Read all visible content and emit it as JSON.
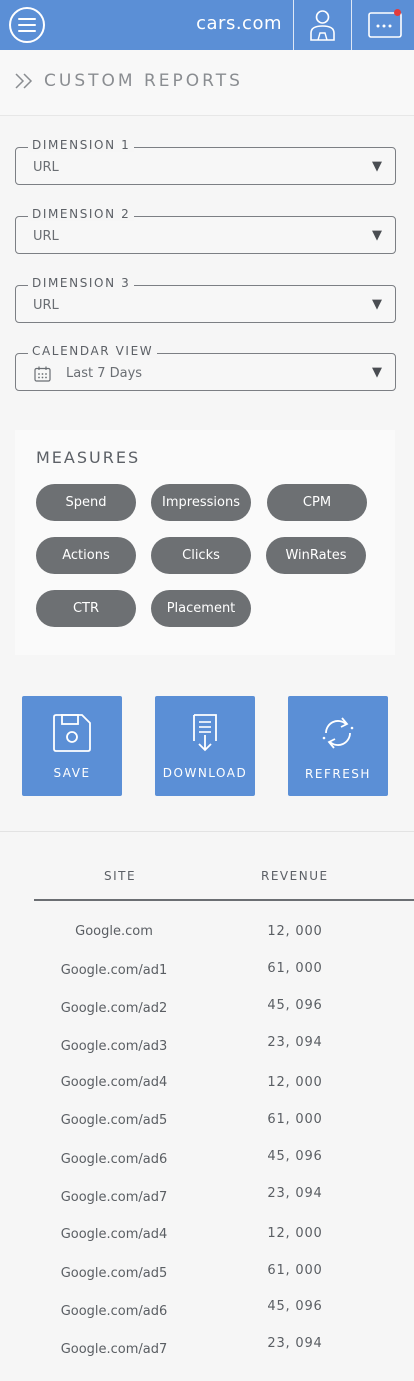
{
  "header": {
    "brand": "cars.com"
  },
  "page": {
    "title": "CUSTOM REPORTS"
  },
  "dimensions": [
    {
      "label": "DIMENSION 1",
      "value": "URL"
    },
    {
      "label": "DIMENSION 2",
      "value": "URL"
    },
    {
      "label": "DIMENSION 3",
      "value": "URL"
    }
  ],
  "calendar": {
    "label": "CALENDAR VIEW",
    "value": "Last 7 Days"
  },
  "measures": {
    "title": "MEASURES",
    "chips": [
      "Spend",
      "Impressions",
      "CPM",
      "Actions",
      "Clicks",
      "WinRates",
      "CTR",
      "Placement"
    ]
  },
  "actions": {
    "save": "SAVE",
    "download": "DOWNLOAD",
    "refresh": "REFRESH"
  },
  "table": {
    "col_site": "SITE",
    "col_revenue": "REVENUE",
    "rows": [
      {
        "site": "Google.com",
        "revenue": "12, 000"
      },
      {
        "site": "Google.com/ad1",
        "revenue": "61, 000"
      },
      {
        "site": "Google.com/ad2",
        "revenue": "45, 096"
      },
      {
        "site": "Google.com/ad3",
        "revenue": "23, 094"
      },
      {
        "site": "Google.com/ad4",
        "revenue": "12, 000"
      },
      {
        "site": "Google.com/ad5",
        "revenue": "61, 000"
      },
      {
        "site": "Google.com/ad6",
        "revenue": "45, 096"
      },
      {
        "site": "Google.com/ad7",
        "revenue": "23, 094"
      },
      {
        "site": "Google.com/ad4",
        "revenue": "12, 000"
      },
      {
        "site": "Google.com/ad5",
        "revenue": "61, 000"
      },
      {
        "site": "Google.com/ad6",
        "revenue": "45, 096"
      },
      {
        "site": "Google.com/ad7",
        "revenue": "23, 094"
      }
    ]
  },
  "colors": {
    "accent": "#5b8fd6",
    "chip": "#6d7073",
    "notification": "#e53b3b"
  }
}
